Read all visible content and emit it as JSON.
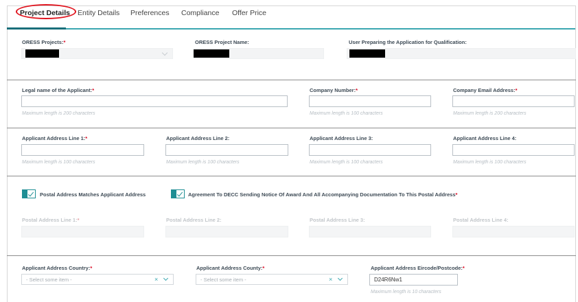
{
  "tabs": [
    {
      "label": "Project Details",
      "active": true
    },
    {
      "label": "Entity Details"
    },
    {
      "label": "Preferences"
    },
    {
      "label": "Compliance"
    },
    {
      "label": "Offer Price"
    }
  ],
  "project": {
    "projects_label": "ORESS Projects:",
    "project_name_label": "ORESS Project Name:",
    "user_preparing_label": "User Preparing the Application for Qualification:"
  },
  "applicant": {
    "legal_name_label": "Legal name of the Applicant:",
    "legal_name_hint": "Maximum length is 200 characters",
    "company_number_label": "Company Number:",
    "company_number_hint": "Maximum length is 100 characters",
    "company_email_label": "Company Email Address:",
    "company_email_hint": "Maximum length is 200 characters"
  },
  "address": {
    "line1_label": "Applicant Address Line 1:",
    "line2_label": "Applicant Address Line 2:",
    "line3_label": "Applicant Address Line 3:",
    "line4_label": "Applicant Address Line 4:",
    "hint": "Maximum length is 100 characters"
  },
  "checkboxes": {
    "postal_match_label": "Postal Address Matches Applicant Address",
    "decc_agreement_label": "Agreement To DECC Sending Notice Of Award And All Accompanying Documentation To This Postal Address"
  },
  "postal": {
    "line1_label": "Postal Address Line 1:",
    "line2_label": "Postal Address Line 2:",
    "line3_label": "Postal Address Line 3:",
    "line4_label": "Postal Address Line 4:"
  },
  "location": {
    "country_label": "Applicant Address Country:",
    "county_label": "Applicant Address County:",
    "eircode_label": "Applicant Address Eircode/Postcode:",
    "select_placeholder": "- Select some item -",
    "eircode_value": "D24R6Nw1",
    "eircode_hint": "Maximum length is 10 characters"
  },
  "required_mark": "*",
  "clear_glyph": "×",
  "colors": {
    "accent": "#3aa7b0",
    "accent_dark": "#1f8e94",
    "required": "#d9001b",
    "highlight_circle": "#e0141e"
  }
}
